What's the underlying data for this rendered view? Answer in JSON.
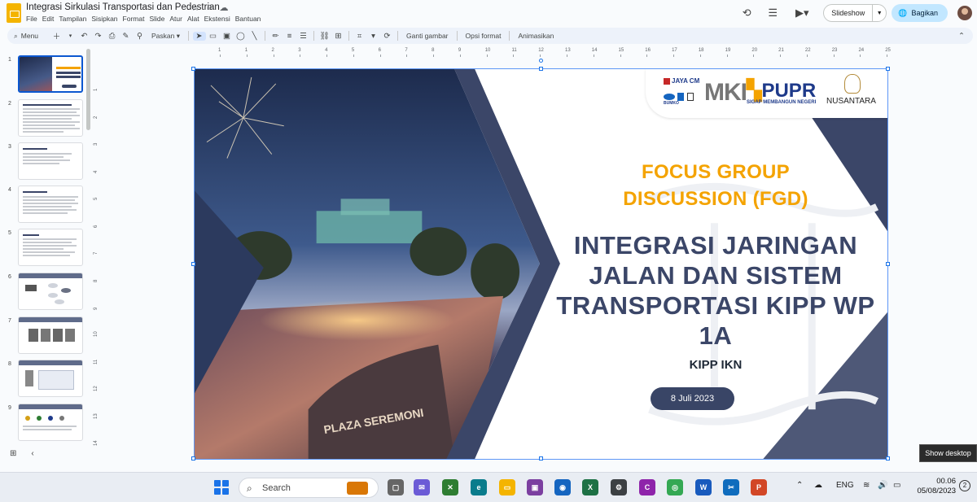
{
  "window": {
    "doc_title": "Integrasi Sirkulasi Transportasi dan Pedestrian",
    "menu": [
      "File",
      "Edit",
      "Tampilan",
      "Sisipkan",
      "Format",
      "Slide",
      "Atur",
      "Alat",
      "Ekstensi",
      "Bantuan"
    ],
    "slideshow_label": "Slideshow",
    "share_label": "Bagikan"
  },
  "toolbar": {
    "search_label": "Menu",
    "fit_label": "Paskan",
    "replace_image": "Ganti gambar",
    "format_options": "Opsi format",
    "animate": "Animasikan"
  },
  "filmstrip": {
    "slides": [
      {
        "num": "1"
      },
      {
        "num": "2"
      },
      {
        "num": "3"
      },
      {
        "num": "4"
      },
      {
        "num": "5"
      },
      {
        "num": "6"
      },
      {
        "num": "7"
      },
      {
        "num": "8"
      },
      {
        "num": "9"
      }
    ]
  },
  "ruler": {
    "top": [
      "1",
      "1",
      "2",
      "3",
      "4",
      "5",
      "6",
      "7",
      "8",
      "9",
      "10",
      "11",
      "12",
      "13",
      "14",
      "15",
      "16",
      "17",
      "18",
      "19",
      "20",
      "21",
      "22",
      "23",
      "24",
      "25"
    ],
    "left": [
      "1",
      "2",
      "3",
      "4",
      "5",
      "6",
      "7",
      "8",
      "9",
      "10",
      "11",
      "12",
      "13",
      "14"
    ]
  },
  "slide": {
    "logos": {
      "jaya": "JAYA CM",
      "mki": "MKI",
      "pupr": "PUPR",
      "pupr_tagline": "SIGAP MEMBANGUN NEGERI",
      "nusantara": "NUSANTARA",
      "sub_logo": "BUMKO"
    },
    "fgd_line1": "FOCUS GROUP",
    "fgd_line2": "DISCUSSION (FGD)",
    "title_line1": "INTEGRASI JARINGAN",
    "title_line2": "JALAN DAN SISTEM",
    "title_line3": "TRANSPORTASI KIPP WP",
    "title_line4": "1A",
    "subtitle": "KIPP IKN",
    "date": "8 Juli 2023",
    "photo_sign": "PLAZA SEREMONI"
  },
  "tooltip": "Show desktop",
  "taskbar": {
    "search_label": "Search",
    "lang": "ENG",
    "time": "00.06",
    "date": "05/08/2023",
    "notif_count": "2"
  }
}
